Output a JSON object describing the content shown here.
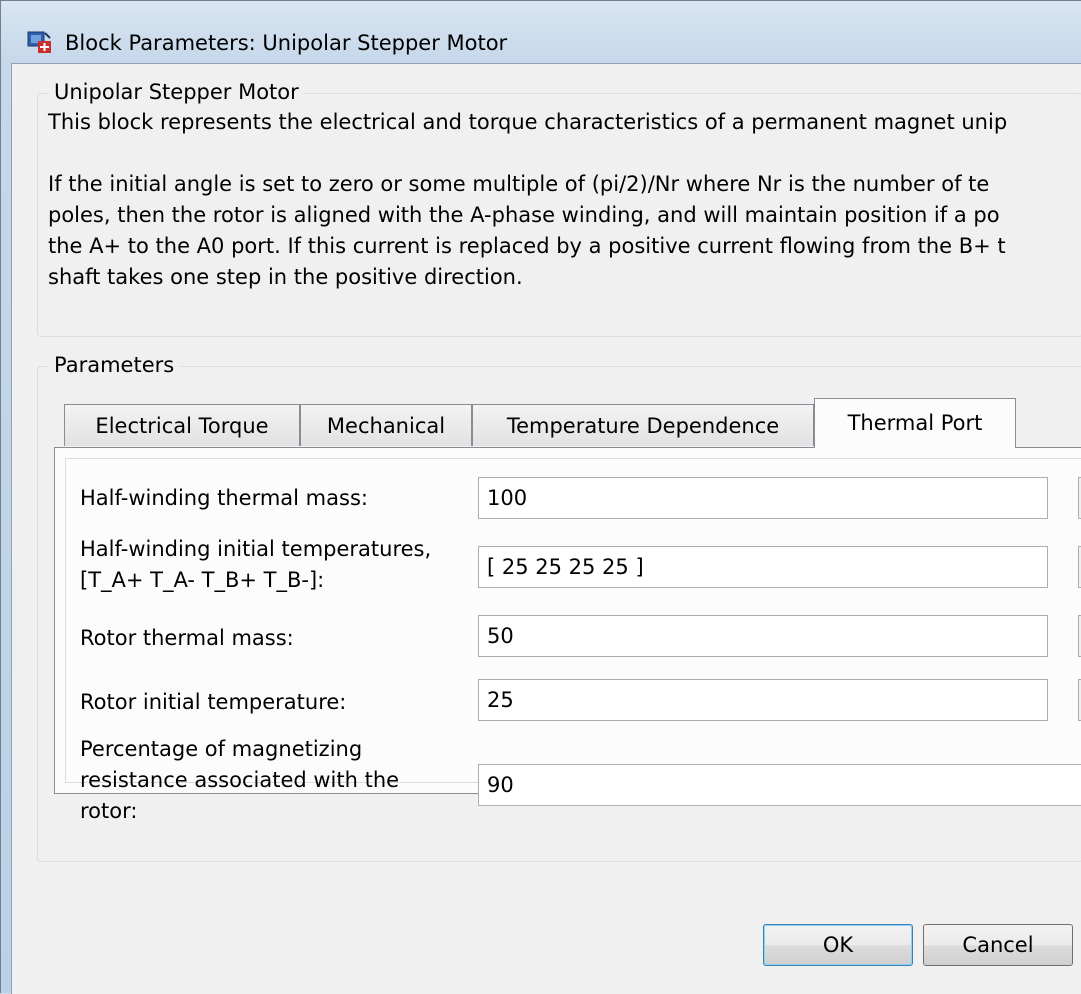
{
  "window": {
    "title": "Block Parameters: Unipolar Stepper Motor",
    "icon": "simulink-block-icon"
  },
  "description": {
    "group_title": "Unipolar Stepper Motor",
    "lines": [
      "This block represents the electrical and torque characteristics of a permanent magnet unip",
      "",
      "If the initial angle is set to zero or some multiple of (pi/2)/Nr where Nr is the number of te",
      "poles, then the rotor is aligned with the A-phase winding, and will maintain position if a po",
      "the A+ to the A0 port. If this current is replaced by a positive current flowing from the B+ t",
      "shaft takes one step in the positive direction."
    ]
  },
  "parameters": {
    "group_title": "Parameters",
    "tabs": [
      {
        "label": "Electrical Torque",
        "active": false
      },
      {
        "label": "Mechanical",
        "active": false
      },
      {
        "label": "Temperature Dependence",
        "active": false
      },
      {
        "label": "Thermal Port",
        "active": true
      }
    ],
    "fields": [
      {
        "label_lines": [
          "Half-winding thermal mass:"
        ],
        "value": "100"
      },
      {
        "label_lines": [
          "Half-winding initial temperatures,",
          "[T_A+ T_A- T_B+ T_B-]:"
        ],
        "value": "[ 25 25 25 25 ]"
      },
      {
        "label_lines": [
          "Rotor thermal mass:"
        ],
        "value": "50"
      },
      {
        "label_lines": [
          "Rotor initial temperature:"
        ],
        "value": "25"
      },
      {
        "label_lines": [
          "Percentage of magnetizing",
          "resistance associated with the",
          "rotor:"
        ],
        "value": "90"
      }
    ]
  },
  "buttons": {
    "ok": "OK",
    "cancel": "Cancel"
  },
  "colors": {
    "titlebar": "#c6d8ea",
    "dialog_bg": "#f0f0f0",
    "tab_panel_bg": "#fcfcfc",
    "default_button_border": "#3c7fb1"
  }
}
